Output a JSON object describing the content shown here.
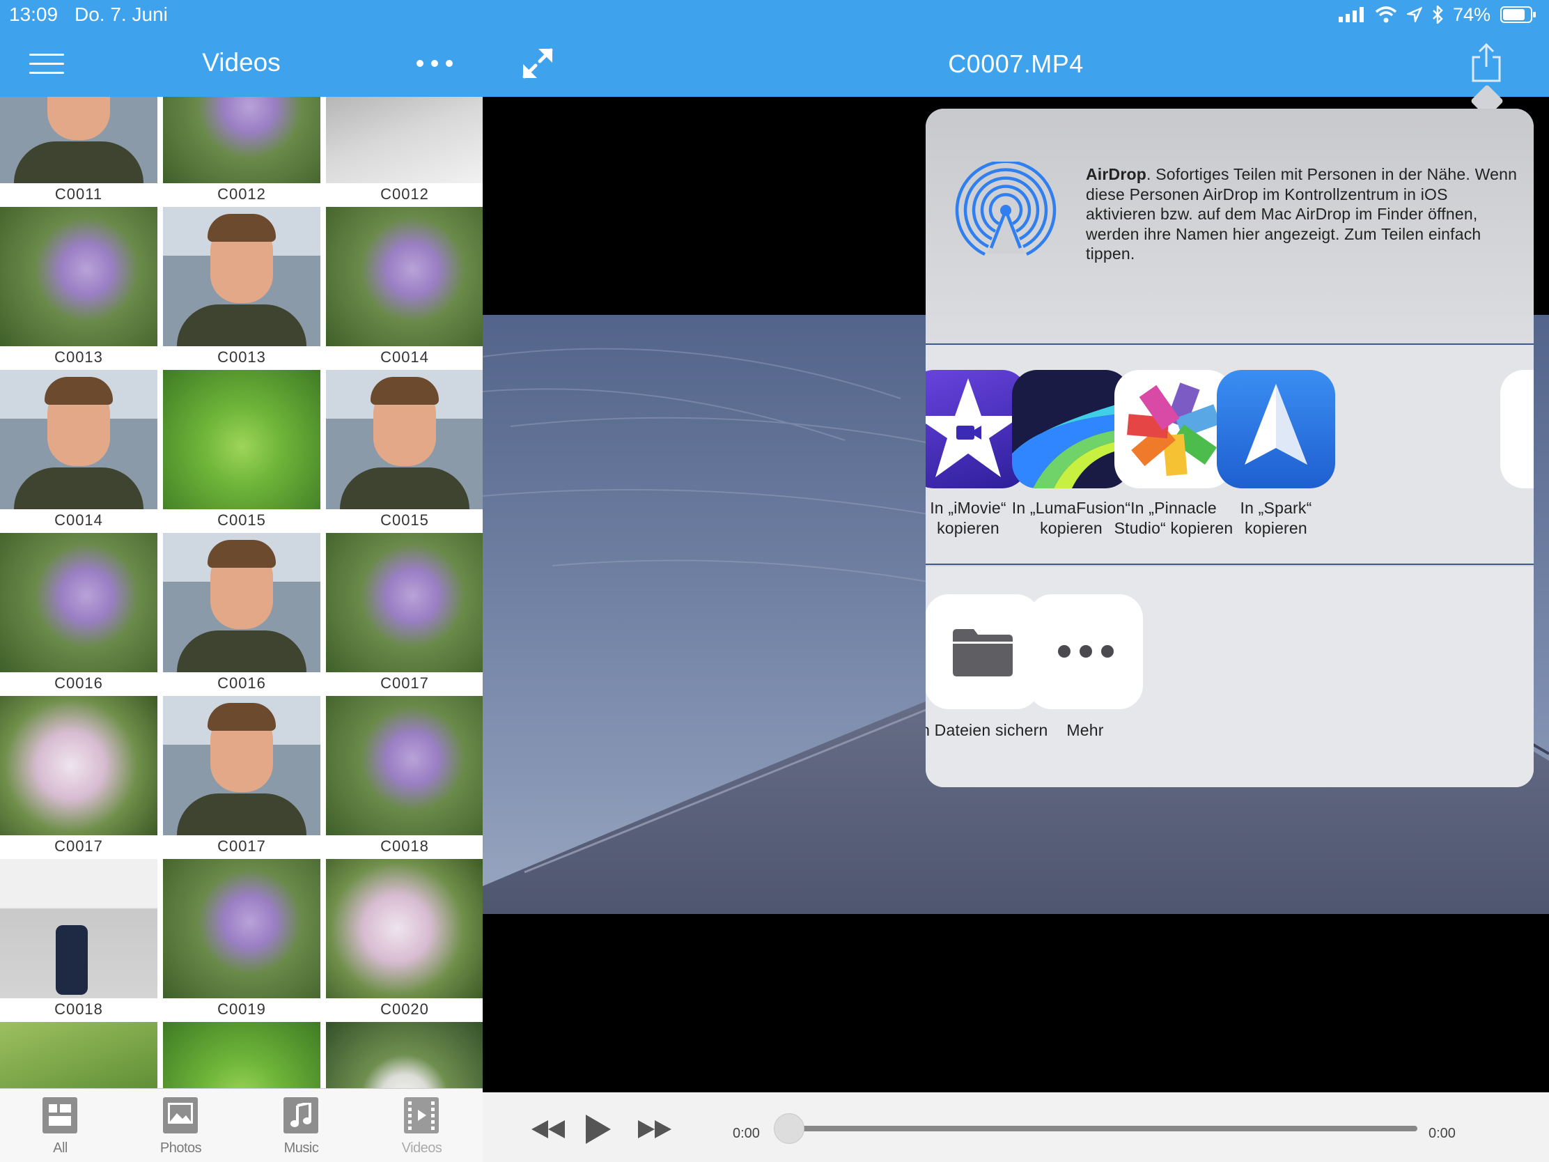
{
  "status_bar": {
    "time": "13:09",
    "date": "Do. 7. Juni",
    "battery": "74%"
  },
  "left_panel": {
    "title": "Videos",
    "items": [
      {
        "caption": "C0011",
        "scene": "face"
      },
      {
        "caption": "C0012",
        "scene": "flower"
      },
      {
        "caption": "C0012",
        "scene": "grey"
      },
      {
        "caption": "C0013",
        "scene": "flower"
      },
      {
        "caption": "C0013",
        "scene": "face"
      },
      {
        "caption": "C0014",
        "scene": "flower"
      },
      {
        "caption": "C0014",
        "scene": "face"
      },
      {
        "caption": "C0015",
        "scene": "leaf"
      },
      {
        "caption": "C0015",
        "scene": "face"
      },
      {
        "caption": "C0016",
        "scene": "flower"
      },
      {
        "caption": "C0016",
        "scene": "face"
      },
      {
        "caption": "C0017",
        "scene": "flower"
      },
      {
        "caption": "C0017",
        "scene": "flower-white"
      },
      {
        "caption": "C0017",
        "scene": "face"
      },
      {
        "caption": "C0018",
        "scene": "flower"
      },
      {
        "caption": "C0018",
        "scene": "object"
      },
      {
        "caption": "C0019",
        "scene": "flower"
      },
      {
        "caption": "C0020",
        "scene": "flower-white"
      },
      {
        "caption": "",
        "scene": "green"
      },
      {
        "caption": "",
        "scene": "leaf"
      },
      {
        "caption": "",
        "scene": "dandelion"
      }
    ]
  },
  "tab_bar": {
    "tabs": [
      {
        "label": "All",
        "icon": "grid-icon"
      },
      {
        "label": "Photos",
        "icon": "photo-icon"
      },
      {
        "label": "Music",
        "icon": "music-note-icon"
      },
      {
        "label": "Videos",
        "icon": "film-icon"
      }
    ]
  },
  "player": {
    "title": "C0007.MP4",
    "time_elapsed": "0:00",
    "time_total": "0:00",
    "progress": 0
  },
  "share_sheet": {
    "airdrop_title": "AirDrop",
    "airdrop_text": ". Sofortiges Teilen mit Personen in der Nähe. Wenn diese Personen AirDrop im Kontrollzentrum in iOS aktivieren bzw. auf dem Mac AirDrop im Finder öffnen, werden ihre Namen hier angezeigt. Zum Teilen einfach tippen.",
    "apps": [
      {
        "label": "In „iMovie“ kopieren",
        "icon": "imovie-icon"
      },
      {
        "label": "In „LumaFusion“ kopieren",
        "icon": "lumafusion-icon"
      },
      {
        "label": "In „Pinnacle Studio“ kopieren",
        "icon": "pinnacle-icon"
      },
      {
        "label": "In „Spark“ kopieren",
        "icon": "spark-icon"
      }
    ],
    "actions": [
      {
        "label": "In Dateien sichern",
        "icon": "folder-icon"
      },
      {
        "label": "Mehr",
        "icon": "more-icon"
      }
    ]
  },
  "colors": {
    "nav_blue": "#3fa2ec",
    "airdrop_blue": "#2f7ff0"
  }
}
